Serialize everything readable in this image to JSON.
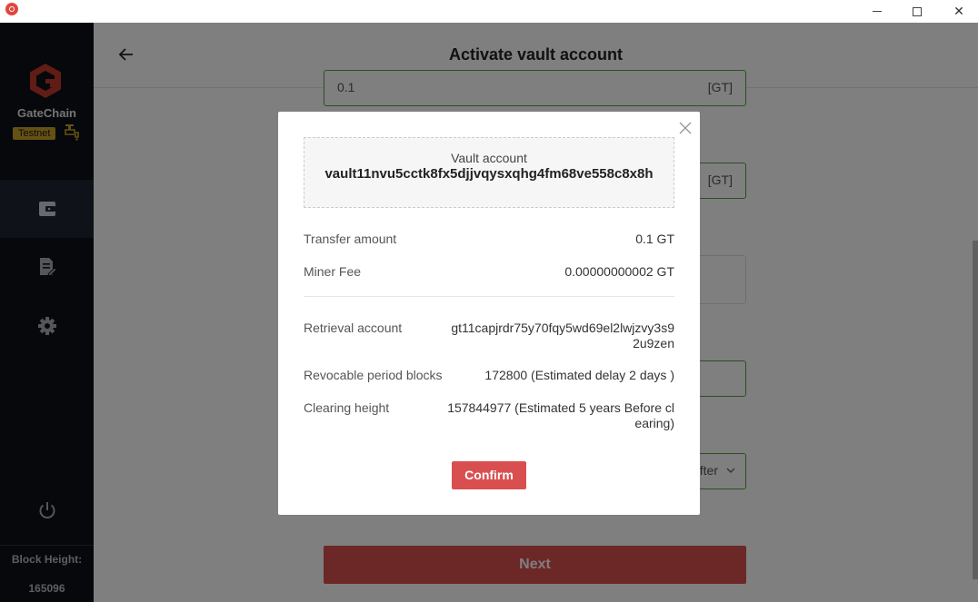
{
  "window": {
    "minimize_label": "",
    "maximize_label": "",
    "close_label": "✕"
  },
  "sidebar": {
    "brand": "GateChain",
    "network_badge": "Testnet",
    "block_height_label": "Block Height:",
    "block_height_value": "165096",
    "items": [
      {
        "icon": "wallet-icon",
        "active": true
      },
      {
        "icon": "document-edit-icon",
        "active": false
      },
      {
        "icon": "gear-icon",
        "active": false
      }
    ],
    "power_icon": "power-icon"
  },
  "header": {
    "title": "Activate vault account"
  },
  "form": {
    "field1_text": "0.1",
    "field1_unit": "[GT]",
    "field2_unit": "[GT]",
    "field5_unit": "fter",
    "next_label": "Next"
  },
  "modal": {
    "vault_label": "Vault account",
    "vault_value": "vault11nvu5cctk8fx5djjvqysxqhg4fm68ve558c8x8h",
    "rows": [
      {
        "label": "Transfer amount",
        "value": "0.1 GT"
      },
      {
        "label": "Miner Fee",
        "value": "0.00000000002 GT"
      },
      {
        "label": "Retrieval account",
        "value": "gt11capjrdr75y70fqy5wd69el2lwjzvy3s92u9zen"
      },
      {
        "label": "Revocable period blocks",
        "value": "172800 (Estimated delay 2 days )"
      },
      {
        "label": "Clearing height",
        "value": "157844977 (Estimated 5 years Before clearing)"
      }
    ],
    "confirm_label": "Confirm"
  },
  "colors": {
    "sidebar_bg": "#0c1017",
    "accent_red": "#d94f4f",
    "field_border_green": "#52a33e",
    "badge_gold": "#c9a227"
  }
}
